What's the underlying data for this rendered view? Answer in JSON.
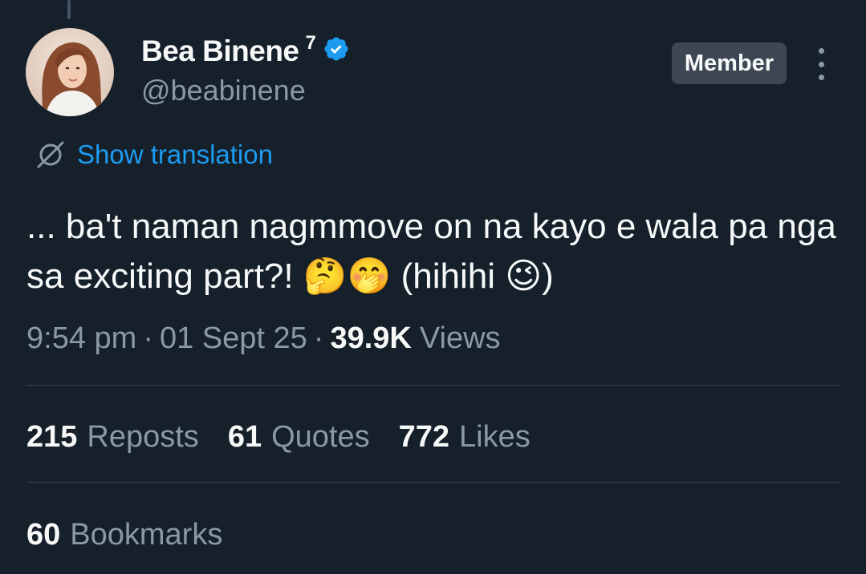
{
  "author": {
    "display_name": "Bea Binene",
    "name_suffix": "7",
    "handle": "@beabinene",
    "verified_color": "#1d9bf0"
  },
  "badge": {
    "label": "Member"
  },
  "translation": {
    "label": "Show translation",
    "icon": "globe-slash-icon"
  },
  "tweet": {
    "text": "... ba't naman nagmmove on na kayo e wala pa nga sa exciting part?! 🤔🤭 (hihihi 😉)"
  },
  "meta": {
    "time": "9:54 pm",
    "separator": "·",
    "date": "01 Sept 25",
    "views_count": "39.9K",
    "views_label": "Views"
  },
  "stats": [
    {
      "count": "215",
      "label": "Reposts"
    },
    {
      "count": "61",
      "label": "Quotes"
    },
    {
      "count": "772",
      "label": "Likes"
    }
  ],
  "bookmarks": {
    "count": "60",
    "label": "Bookmarks"
  },
  "colors": {
    "background": "#15202b",
    "text": "#f7f9f9",
    "secondary": "#8b98a5",
    "accent": "#1d9bf0",
    "divider": "#38444d"
  }
}
